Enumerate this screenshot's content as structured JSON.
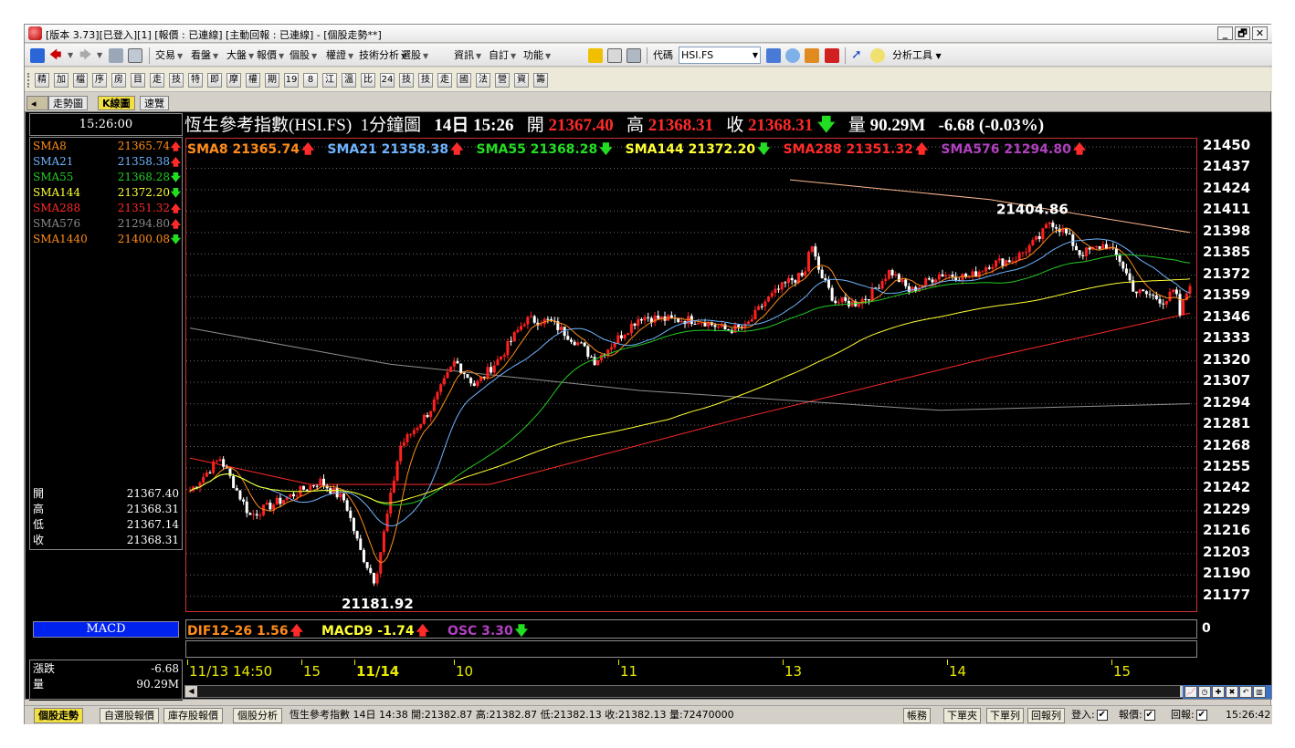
{
  "window": {
    "title": "[版本 3.73][已登入][1] [報價 : 已連線] [主動回報 : 已連線] - [個股走勢**]",
    "min": "_",
    "max": "🗗",
    "close": "✕"
  },
  "toolbar1": {
    "menus": [
      "交易",
      "看盤",
      "大盤",
      "報價",
      "個股",
      "權證",
      "技術分析",
      "選股",
      "資訊",
      "自訂",
      "功能"
    ],
    "code_label": "代碼",
    "code_value": "HSI.FS",
    "tools_label": "分析工具"
  },
  "toolbar2": {
    "buttons": [
      "精",
      "加",
      "檔",
      "序",
      "房",
      "目",
      "走",
      "技",
      "特",
      "即",
      "摩",
      "權",
      "期",
      "19",
      "8",
      "江",
      "溫",
      "比",
      "24",
      "技",
      "技",
      "走",
      "國",
      "法",
      "營",
      "資",
      "籌"
    ]
  },
  "view_tabs": [
    "走勢圖",
    "K線圖",
    "速覽"
  ],
  "left_panel": {
    "time": "15:26:00",
    "sma": [
      {
        "name": "SMA8",
        "value": "21365.74",
        "dir": "up",
        "color": "#ff8c1a"
      },
      {
        "name": "SMA21",
        "value": "21358.38",
        "dir": "up",
        "color": "#6fb4ff"
      },
      {
        "name": "SMA55",
        "value": "21368.28",
        "dir": "down",
        "color": "#22cc22"
      },
      {
        "name": "SMA144",
        "value": "21372.20",
        "dir": "down",
        "color": "#ffff33"
      },
      {
        "name": "SMA288",
        "value": "21351.32",
        "dir": "up",
        "color": "#ff2a2a"
      },
      {
        "name": "SMA576",
        "value": "21294.80",
        "dir": "up",
        "color": "#8a8a8a"
      },
      {
        "name": "SMA1440",
        "value": "21400.08",
        "dir": "down",
        "color": "#ff8c1a"
      }
    ],
    "ohlc": [
      {
        "label": "開",
        "value": "21367.40"
      },
      {
        "label": "高",
        "value": "21368.31"
      },
      {
        "label": "低",
        "value": "21367.14"
      },
      {
        "label": "收",
        "value": "21368.31"
      }
    ],
    "indicator_button": "MACD",
    "change": {
      "label": "漲跌",
      "value": "-6.68"
    },
    "volume": {
      "label": "量",
      "value": "90.29M"
    }
  },
  "header": {
    "name": "恆生參考指數(HSI.FS)",
    "period": "1分鐘圖",
    "datetime": "14日 15:26",
    "open_label": "開",
    "open": "21367.40",
    "high_label": "高",
    "high": "21368.31",
    "close_label": "收",
    "close": "21368.31",
    "close_arrow": "🡇",
    "vol_label": "量",
    "vol": "90.29M",
    "change": "-6.68 (-0.03%)"
  },
  "sma_legend": [
    {
      "text": "SMA8 21365.74",
      "arrow": "🡅",
      "color": "#ff8c1a",
      "arrow_color": "#ff2a2a"
    },
    {
      "text": "SMA21 21358.38",
      "arrow": "🡅",
      "color": "#6fb4ff",
      "arrow_color": "#ff2a2a"
    },
    {
      "text": "SMA55 21368.28",
      "arrow": "🡇",
      "color": "#22dd22",
      "arrow_color": "#22dd22"
    },
    {
      "text": "SMA144 21372.20",
      "arrow": "🡇",
      "color": "#ffff33",
      "arrow_color": "#22dd22"
    },
    {
      "text": "SMA288 21351.32",
      "arrow": "🡅",
      "color": "#ff2a2a",
      "arrow_color": "#ff2a2a"
    },
    {
      "text": "SMA576 21294.80",
      "arrow": "🡅",
      "color": "#b040c0",
      "arrow_color": "#ff2a2a"
    }
  ],
  "macd_legend": [
    {
      "text": "DIF12-26 1.56",
      "arrow": "🡅",
      "color": "#ff8c1a",
      "arrow_color": "#ff2a2a"
    },
    {
      "text": "MACD9 -1.74",
      "arrow": "🡅",
      "color": "#ffff33",
      "arrow_color": "#ff2a2a"
    },
    {
      "text": "OSC 3.30",
      "arrow": "🡇",
      "color": "#b040c0",
      "arrow_color": "#22dd22"
    }
  ],
  "macd_zero": "0",
  "statusbar": {
    "tabs": [
      "個股走勢",
      "自選股報價",
      "庫存股報價",
      "個股分析"
    ],
    "text": "恆生參考指數 14日 14:38 開:21382.87 高:21382.87 低:21382.13 收:21382.13 量:72470000",
    "buttons": [
      "帳務",
      "下單夾",
      "下單列",
      "回報列"
    ],
    "login_label": "登入:",
    "quote_label": "報價:",
    "report_label": "回報:",
    "clock": "15:26:42"
  },
  "chart_data": {
    "type": "candlestick",
    "title": "恆生參考指數(HSI.FS) 1分鐘圖",
    "y_ticks": [
      21450,
      21437,
      21424,
      21411,
      21398,
      21385,
      21372,
      21359,
      21346,
      21333,
      21320,
      21307,
      21294,
      21281,
      21268,
      21255,
      21242,
      21229,
      21216,
      21203,
      21190,
      21177
    ],
    "ylim": [
      21168,
      21455
    ],
    "x_ticks": [
      "11/13 14:50",
      "15",
      "11/14",
      "10",
      "11",
      "13",
      "14",
      "15"
    ],
    "annotations": [
      {
        "text": "21181.92",
        "type": "low"
      },
      {
        "text": "21404.86",
        "type": "high"
      }
    ],
    "price_path": [
      [
        0,
        21241
      ],
      [
        0.03,
        21261
      ],
      [
        0.06,
        21226
      ],
      [
        0.09,
        21235
      ],
      [
        0.13,
        21247
      ],
      [
        0.155,
        21235
      ],
      [
        0.17,
        21205
      ],
      [
        0.185,
        21186
      ],
      [
        0.21,
        21268
      ],
      [
        0.24,
        21290
      ],
      [
        0.265,
        21320
      ],
      [
        0.285,
        21305
      ],
      [
        0.31,
        21322
      ],
      [
        0.335,
        21345
      ],
      [
        0.36,
        21344
      ],
      [
        0.39,
        21330
      ],
      [
        0.405,
        21320
      ],
      [
        0.43,
        21335
      ],
      [
        0.45,
        21347
      ],
      [
        0.48,
        21345
      ],
      [
        0.51,
        21345
      ],
      [
        0.535,
        21339
      ],
      [
        0.555,
        21340
      ],
      [
        0.575,
        21356
      ],
      [
        0.6,
        21369
      ],
      [
        0.615,
        21372
      ],
      [
        0.62,
        21392
      ],
      [
        0.63,
        21373
      ],
      [
        0.645,
        21356
      ],
      [
        0.665,
        21355
      ],
      [
        0.68,
        21360
      ],
      [
        0.7,
        21375
      ],
      [
        0.72,
        21362
      ],
      [
        0.75,
        21373
      ],
      [
        0.78,
        21371
      ],
      [
        0.8,
        21379
      ],
      [
        0.825,
        21382
      ],
      [
        0.85,
        21395
      ],
      [
        0.86,
        21405
      ],
      [
        0.875,
        21398
      ],
      [
        0.89,
        21385
      ],
      [
        0.905,
        21388
      ],
      [
        0.915,
        21391
      ],
      [
        0.93,
        21381
      ],
      [
        0.945,
        21362
      ],
      [
        0.96,
        21360
      ],
      [
        0.975,
        21356
      ],
      [
        0.985,
        21363
      ],
      [
        0.99,
        21348
      ],
      [
        1.0,
        21368
      ]
    ]
  }
}
